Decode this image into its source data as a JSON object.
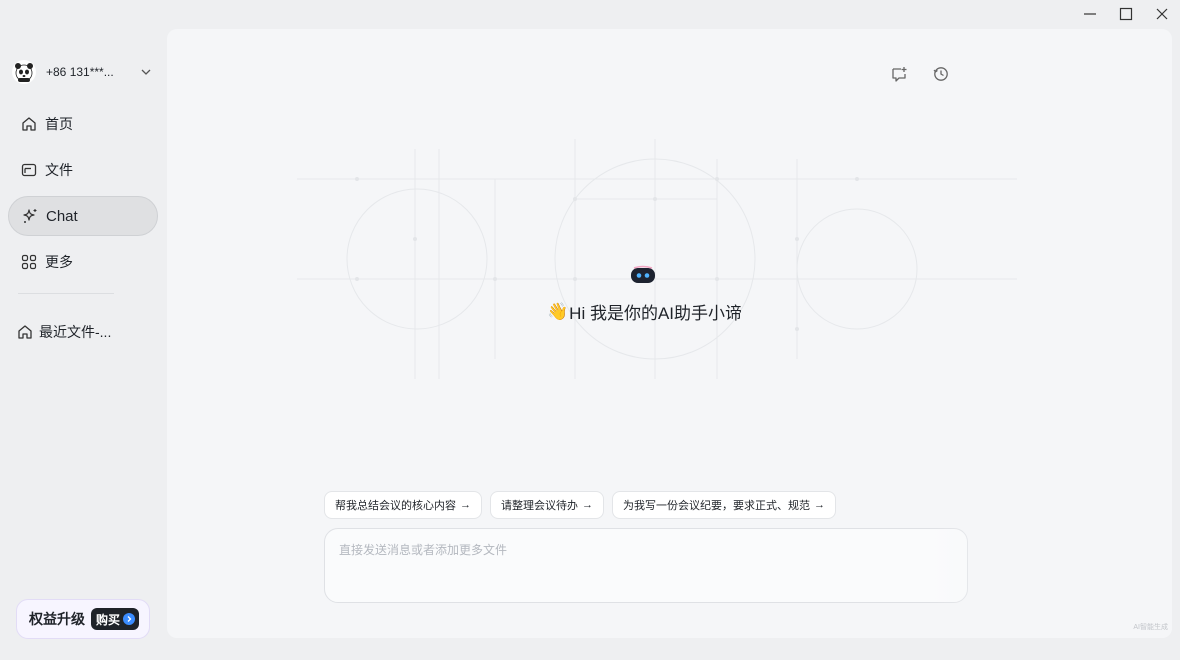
{
  "window": {
    "controls": [
      "minimize-icon",
      "maximize-icon",
      "close-icon"
    ]
  },
  "sidebar": {
    "account": {
      "name": "+86 131***...",
      "icon": "chevron-down-icon"
    },
    "items": [
      {
        "label": "首页",
        "icon": "home-icon"
      },
      {
        "label": "文件",
        "icon": "folder-icon"
      },
      {
        "label": "Chat",
        "icon": "sparkle-icon",
        "active": true
      },
      {
        "label": "更多",
        "icon": "grid-icon"
      }
    ],
    "recent": {
      "label": "最近文件-...",
      "icon": "home-icon"
    },
    "upgrade": {
      "label": "权益升级",
      "buy": "购买"
    }
  },
  "main": {
    "top_icons": [
      "new-chat-icon",
      "history-icon"
    ],
    "greeting": {
      "wave": "👋",
      "text": "Hi 我是你的AI助手小谛"
    },
    "suggestions": [
      "帮我总结会议的核心内容",
      "请整理会议待办",
      "为我写一份会议纪要，要求正式、规范"
    ],
    "input": {
      "placeholder": "直接发送消息或者添加更多文件",
      "value": ""
    },
    "watermark": "AI智能生成"
  },
  "colors": {
    "background": "#eeeff1",
    "panel": "#f5f6f8",
    "active_nav": "#dfe0e2",
    "accent": "#3b8cff"
  }
}
